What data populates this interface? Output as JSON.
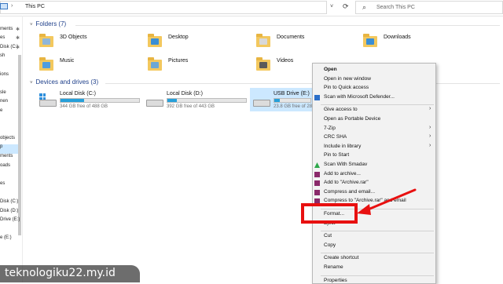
{
  "address_bar": {
    "path": "This PC",
    "separator": "›"
  },
  "search": {
    "placeholder": "Search This PC"
  },
  "nav": {
    "items": [
      {
        "label": "",
        "pinned": false
      },
      {
        "label": "ments",
        "pinned": true
      },
      {
        "label": "es",
        "pinned": true
      },
      {
        "label": "Disk (C:)",
        "pinned": true
      },
      {
        "label": "sh",
        "pinned": false
      },
      {
        "label": "",
        "pinned": false
      },
      {
        "label": "ions",
        "pinned": false
      },
      {
        "label": "",
        "pinned": false
      },
      {
        "label": "sle",
        "pinned": false
      },
      {
        "label": "nen",
        "pinned": false
      },
      {
        "label": "e",
        "pinned": false
      },
      {
        "label": "",
        "pinned": false
      },
      {
        "label": "",
        "pinned": false
      },
      {
        "label": "objects",
        "pinned": false
      },
      {
        "label": "p",
        "pinned": false
      },
      {
        "label": "ments",
        "pinned": false
      },
      {
        "label": "oads",
        "pinned": false
      },
      {
        "label": "",
        "pinned": false
      },
      {
        "label": "es",
        "pinned": false
      },
      {
        "label": "",
        "pinned": false
      },
      {
        "label": "Disk (C:)",
        "pinned": false
      },
      {
        "label": "Disk (D:)",
        "pinned": false
      },
      {
        "label": "Drive (E:)",
        "pinned": false
      },
      {
        "label": "",
        "pinned": false
      },
      {
        "label": "e (E:)",
        "pinned": false
      }
    ]
  },
  "folders_section": {
    "chevron": "˅",
    "title": "Folders (7)"
  },
  "folders": [
    {
      "label": "3D Objects",
      "icon": "3d-objects-folder-icon"
    },
    {
      "label": "Desktop",
      "icon": "desktop-folder-icon"
    },
    {
      "label": "Documents",
      "icon": "documents-folder-icon"
    },
    {
      "label": "Downloads",
      "icon": "downloads-folder-icon"
    },
    {
      "label": "Music",
      "icon": "music-folder-icon"
    },
    {
      "label": "Pictures",
      "icon": "pictures-folder-icon"
    },
    {
      "label": "Videos",
      "icon": "videos-folder-icon"
    }
  ],
  "drives_section": {
    "chevron": "˅",
    "title": "Devices and drives (3)"
  },
  "drives": [
    {
      "label": "Local Disk (C:)",
      "free_text": "344 GB free of 488 GB",
      "used_fraction": 0.3
    },
    {
      "label": "Local Disk (D:)",
      "free_text": "392 GB free of 443 GB",
      "used_fraction": 0.12
    },
    {
      "label": "USB Drive (E:)",
      "free_text": "23.8 GB free of 28",
      "used_fraction": 0.15,
      "selected": true
    }
  ],
  "context_menu": {
    "items": [
      {
        "label": "Open",
        "bold": true,
        "submenu": false,
        "icon": ""
      },
      {
        "label": "Open in new window",
        "submenu": false,
        "icon": ""
      },
      {
        "label": "Pin to Quick access",
        "submenu": false,
        "icon": ""
      },
      {
        "label": "Scan with Microsoft Defender...",
        "submenu": false,
        "icon": "defender-icon"
      },
      {
        "sep": true
      },
      {
        "label": "Give access to",
        "submenu": true,
        "icon": ""
      },
      {
        "label": "Open as Portable Device",
        "submenu": false,
        "icon": ""
      },
      {
        "label": "7-Zip",
        "submenu": true,
        "icon": ""
      },
      {
        "label": "CRC SHA",
        "submenu": true,
        "icon": ""
      },
      {
        "label": "Include in library",
        "submenu": true,
        "icon": ""
      },
      {
        "label": "Pin to Start",
        "submenu": false,
        "icon": ""
      },
      {
        "label": "Scan With Smadav",
        "submenu": false,
        "icon": "smadav-icon"
      },
      {
        "label": "Add to archive...",
        "submenu": false,
        "icon": "winrar-icon"
      },
      {
        "label": "Add to \"Archive.rar\"",
        "submenu": false,
        "icon": "winrar-icon"
      },
      {
        "label": "Compress and email...",
        "submenu": false,
        "icon": "winrar-icon"
      },
      {
        "label": "Compress to \"Archive.rar\" and email",
        "submenu": false,
        "icon": "winrar-icon"
      },
      {
        "sep": true
      },
      {
        "label": "Format...",
        "submenu": false,
        "icon": "",
        "highlighted": true
      },
      {
        "label": "Eject",
        "submenu": false,
        "icon": ""
      },
      {
        "sep": true
      },
      {
        "label": "Cut",
        "submenu": false,
        "icon": ""
      },
      {
        "label": "Copy",
        "submenu": false,
        "icon": ""
      },
      {
        "sep": true
      },
      {
        "label": "Create shortcut",
        "submenu": false,
        "icon": ""
      },
      {
        "label": "Rename",
        "submenu": false,
        "icon": ""
      },
      {
        "sep": true
      },
      {
        "label": "Properties",
        "submenu": false,
        "icon": ""
      }
    ]
  },
  "watermark": {
    "text": "teknologiku22.my.id"
  },
  "colors": {
    "accent": "#26a0da",
    "selection": "#cce8ff",
    "annotation": "#e81010",
    "folder": "#f3c85e"
  }
}
